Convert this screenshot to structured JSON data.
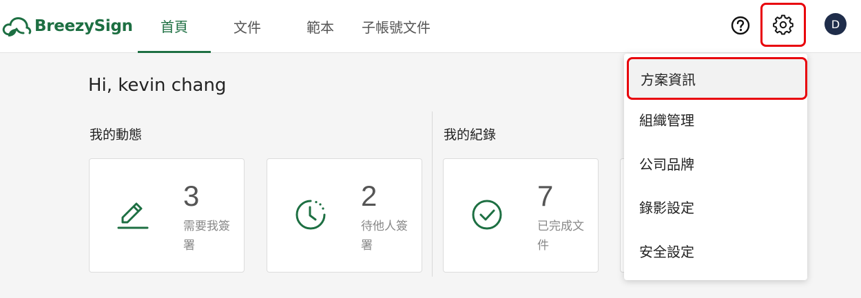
{
  "brand": {
    "name": "BreezySign",
    "color": "#1d6f42"
  },
  "nav": {
    "items": [
      {
        "label": "首頁",
        "active": true
      },
      {
        "label": "文件",
        "active": false
      },
      {
        "label": "範本",
        "active": false
      },
      {
        "label": "子帳號文件",
        "active": false
      }
    ]
  },
  "header": {
    "help_icon": "question-circle-icon",
    "settings_icon": "gear-icon",
    "avatar_initial": "D"
  },
  "greeting": "Hi, kevin chang",
  "sections": {
    "activity": {
      "title": "我的動態",
      "cards": [
        {
          "icon": "pen-icon",
          "count": "3",
          "label": "需要我簽署"
        },
        {
          "icon": "clock-icon",
          "count": "2",
          "label": "待他人簽署"
        }
      ]
    },
    "records": {
      "title": "我的紀錄",
      "cards": [
        {
          "icon": "check-circle-icon",
          "count": "7",
          "label": "已完成文件"
        }
      ]
    }
  },
  "settings_menu": {
    "items": [
      {
        "label": "方案資訊",
        "highlighted": true
      },
      {
        "label": "組織管理"
      },
      {
        "label": "公司品牌"
      },
      {
        "label": "錄影設定"
      },
      {
        "label": "安全設定"
      }
    ]
  },
  "colors": {
    "accent": "#1d6f42",
    "highlight_border": "#e8000a",
    "avatar_bg": "#1f2d4a"
  }
}
